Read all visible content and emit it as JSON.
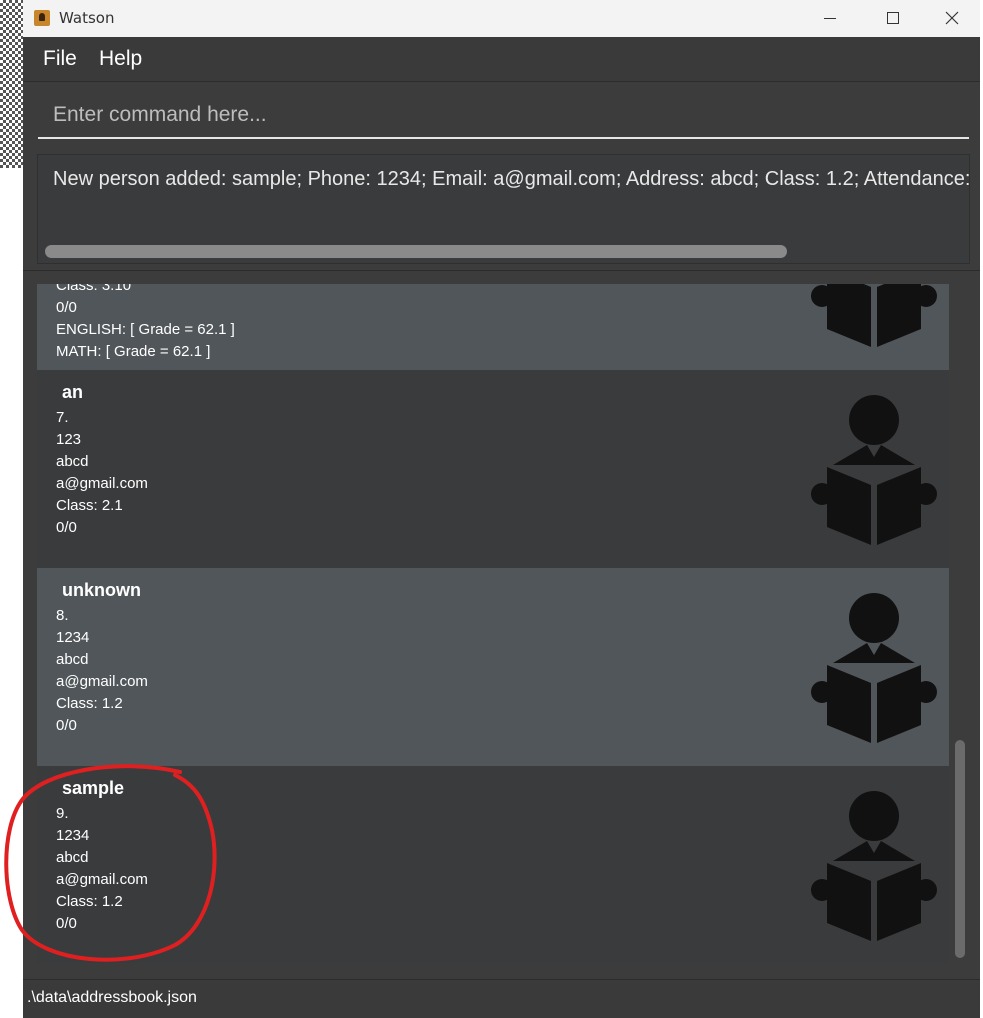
{
  "window": {
    "title": "Watson"
  },
  "menu": {
    "file_label": "File",
    "help_label": "Help"
  },
  "command": {
    "placeholder": "Enter command here...",
    "value": ""
  },
  "result": {
    "message": "New person added: sample; Phone: 1234; Email: a@gmail.com; Address: abcd; Class: 1.2; Attendance:"
  },
  "list": {
    "partial_card": {
      "lines": [
        "Class: 3.10",
        "0/0",
        "ENGLISH: [ Grade = 62.1 ]",
        "MATH: [ Grade = 62.1 ]"
      ]
    },
    "cards": [
      {
        "name": "an",
        "index": "7.",
        "phone": "123",
        "address": "abcd",
        "email": "a@gmail.com",
        "class": "Class: 2.1",
        "attendance": "0/0"
      },
      {
        "name": "unknown",
        "index": "8.",
        "phone": "1234",
        "address": "abcd",
        "email": "a@gmail.com",
        "class": "Class: 1.2",
        "attendance": "0/0"
      },
      {
        "name": "sample",
        "index": "9.",
        "phone": "1234",
        "address": "abcd",
        "email": "a@gmail.com",
        "class": "Class: 1.2",
        "attendance": "0/0"
      }
    ]
  },
  "status": {
    "file_path": ".\\data\\addressbook.json"
  },
  "colors": {
    "background": "#3c3c3c",
    "card_alt": "#50565a",
    "annotation": "#e02020"
  },
  "icons": {
    "person_icon": "reading-person-icon"
  }
}
